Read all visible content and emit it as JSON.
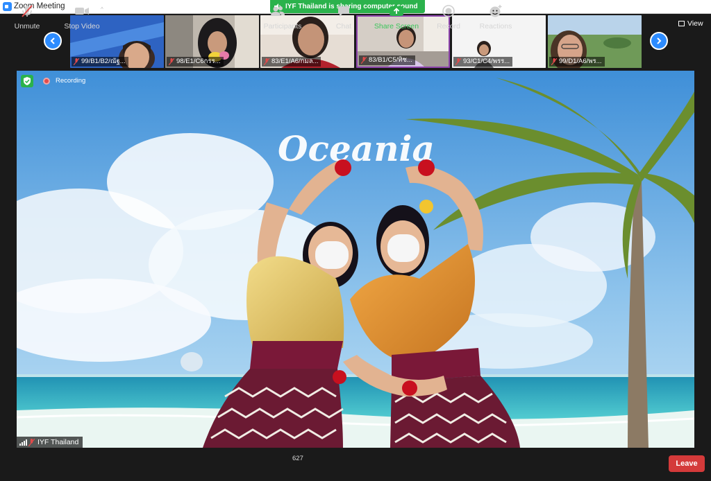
{
  "window": {
    "title": "Zoom Meeting"
  },
  "share_banner": {
    "text": "IYF Thailand is sharing computer sound"
  },
  "view_button": {
    "label": "View"
  },
  "thumbnails": [
    {
      "name": "99/B1/B2/ณัฐ...",
      "bg": "#3a6fc9"
    },
    {
      "name": "98/E1/C6กรร...",
      "bg": "#c9c3bb"
    },
    {
      "name": "83/E1/A6/กมล...",
      "bg": "#d9cfc6"
    },
    {
      "name": "83/B1/C5/ทิช...",
      "bg": "#c8c0b8"
    },
    {
      "name": "93/C1/C4/พรร...",
      "bg": "#f2f2f2"
    },
    {
      "name": "99/D1/A6/พร...",
      "bg": "#7ea565"
    }
  ],
  "stage": {
    "recording_label": "Recording",
    "presenter_name": "IYF Thailand",
    "banner_text": "Oceania"
  },
  "toolbar": {
    "unmute": "Unmute",
    "stop_video": "Stop Video",
    "participants": "Participants",
    "participant_count": "627",
    "chat": "Chat",
    "share_screen": "Share Screen",
    "record": "Record",
    "reactions": "Reactions",
    "leave": "Leave"
  },
  "colors": {
    "accent": "#2d8cff",
    "share_green": "#2bb24c",
    "leave_red": "#d43a3a"
  }
}
